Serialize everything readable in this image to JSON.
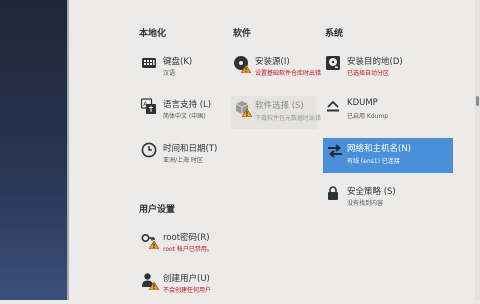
{
  "categories": {
    "localization": "本地化",
    "software": "软件",
    "system": "系统",
    "user_settings": "用户设置"
  },
  "spokes": {
    "keyboard": {
      "title": "键盘(K)",
      "status": "汉语",
      "icon": "keyboard-icon"
    },
    "language": {
      "title": "语言支持 (L)",
      "status": "简体中文 (中国)",
      "icon": "language-icon"
    },
    "time_date": {
      "title": "时间和日期(T)",
      "status": "亚洲/上海 时区",
      "icon": "clock-icon"
    },
    "install_source": {
      "title": "安装源(I)",
      "status": "设置基础软件仓库时出错",
      "icon": "disc-icon"
    },
    "software_selection": {
      "title": "软件选择 (S)",
      "status": "下载软件包元数据时出错",
      "icon": "package-icon"
    },
    "install_destination": {
      "title": "安装目的地(D)",
      "status": "已选择自动分区",
      "icon": "harddisk-icon"
    },
    "kdump": {
      "title": "KDUMP",
      "status": "已启用 Kdump",
      "icon": "kdump-icon"
    },
    "network": {
      "title": "网络和主机名(N)",
      "status": "有线 (ens1) 已连接",
      "icon": "network-icon"
    },
    "security": {
      "title": "安全策略 (S)",
      "status": "没有找到内容",
      "icon": "lock-icon"
    },
    "root_password": {
      "title": "root密码(R)",
      "status": "root 帐户已禁用。",
      "icon": "key-icon"
    },
    "create_user": {
      "title": "创建用户(U)",
      "status": "不会创建任何用户",
      "icon": "user-icon"
    }
  },
  "colors": {
    "accent": "#4a90d9",
    "warning": "#c4161c",
    "background": "#ecebe9",
    "sidebar": "#283552"
  }
}
